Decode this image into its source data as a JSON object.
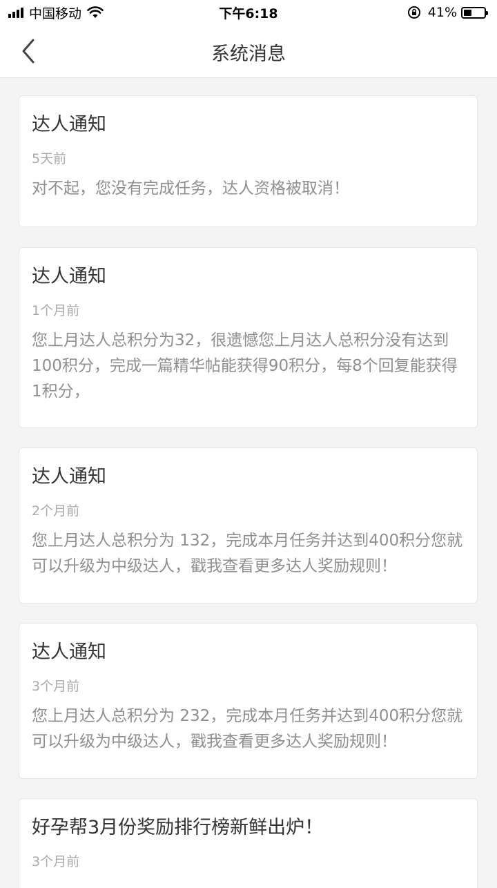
{
  "status_bar": {
    "carrier": "中国移动",
    "time": "下午6:18",
    "battery_percent": "41%",
    "battery_level": 0.41,
    "icons": [
      "signal-icon",
      "wifi-icon",
      "rotation-lock-icon",
      "battery-icon"
    ]
  },
  "nav": {
    "title": "系统消息",
    "back_icon": "chevron-left-icon"
  },
  "messages": [
    {
      "title": "达人通知",
      "time": "5天前",
      "body": "对不起，您没有完成任务，达人资格被取消！"
    },
    {
      "title": "达人通知",
      "time": "1个月前",
      "body": "您上月达人总积分为32，很遗憾您上月达人总积分没有达到100积分，完成一篇精华帖能获得90积分，每8个回复能获得1积分，"
    },
    {
      "title": "达人通知",
      "time": "2个月前",
      "body": "您上月达人总积分为 132，完成本月任务并达到400积分您就可以升级为中级达人，戳我查看更多达人奖励规则！"
    },
    {
      "title": "达人通知",
      "time": "3个月前",
      "body": "您上月达人总积分为 232，完成本月任务并达到400积分您就可以升级为中级达人，戳我查看更多达人奖励规则！"
    },
    {
      "title": "好孕帮3月份奖励排行榜新鲜出炉！",
      "time": "3个月前",
      "body": ""
    }
  ]
}
